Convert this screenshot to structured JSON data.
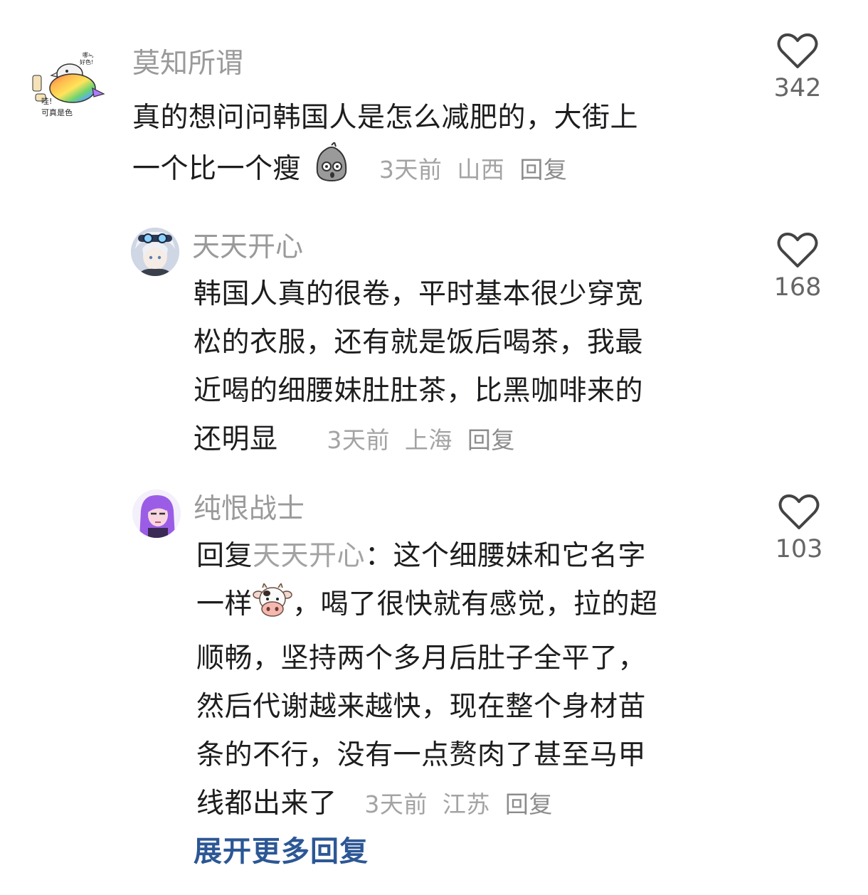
{
  "comments": [
    {
      "username": "莫知所谓",
      "text_line1": "真的想问问韩国人是怎么减肥的，大街上",
      "text_line2": "一个比一个瘦",
      "time": "3天前",
      "location": "山西",
      "reply": "回复",
      "likes": "342",
      "avatar_text_top": "哪鸟 好色!",
      "avatar_text_bottom": "哇! 可真是色",
      "emoji": "shocked-rock-emoji"
    },
    {
      "username": "天天开心",
      "text_line1": "韩国人真的很卷，平时基本很少穿宽",
      "text_line2": "松的衣服，还有就是饭后喝茶，我最",
      "text_line3": "近喝的细腰妹肚肚茶，比黑咖啡来的",
      "text_line4": "还明显",
      "time": "3天前",
      "location": "上海",
      "reply": "回复",
      "likes": "168"
    },
    {
      "username": "纯恨战士",
      "reply_prefix": "回复",
      "mention": "天天开心",
      "text_line1_rest": "：这个细腰妹和它名字",
      "text_line2_a": "一样",
      "text_line2_b": "，喝了很快就有感觉，拉的超",
      "text_line3": "顺畅，坚持两个多月后肚子全平了，",
      "text_line4": "然后代谢越来越快，现在整个身材苗",
      "text_line5": "条的不行，没有一点赘肉了甚至马甲",
      "text_line6": "线都出来了",
      "time": "3天前",
      "location": "江苏",
      "reply": "回复",
      "likes": "103",
      "emoji": "cow-face-emoji"
    }
  ],
  "expand_more": "展开更多回复",
  "colors": {
    "username": "#9a9a9a",
    "meta": "#a3a3a3",
    "expand_link": "#2c5795"
  }
}
